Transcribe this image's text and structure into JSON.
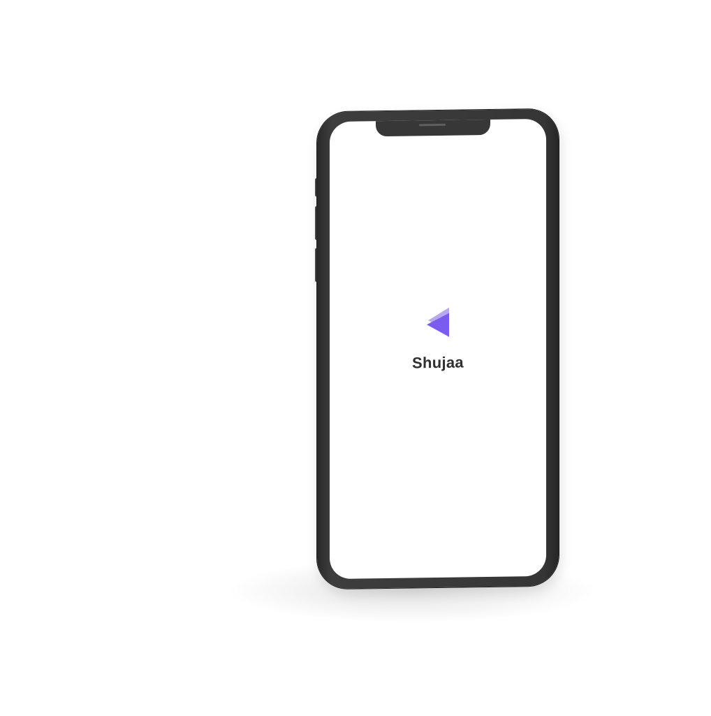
{
  "app": {
    "name": "Shujaa",
    "logo_icon": "play-triangle-logo-icon"
  },
  "colors": {
    "logo_primary": "#7B5CF0",
    "logo_secondary": "#B9A7F5",
    "text": "#2F2F2F",
    "phone_frame": "#3A3A3A",
    "screen_background": "#FFFFFF"
  }
}
